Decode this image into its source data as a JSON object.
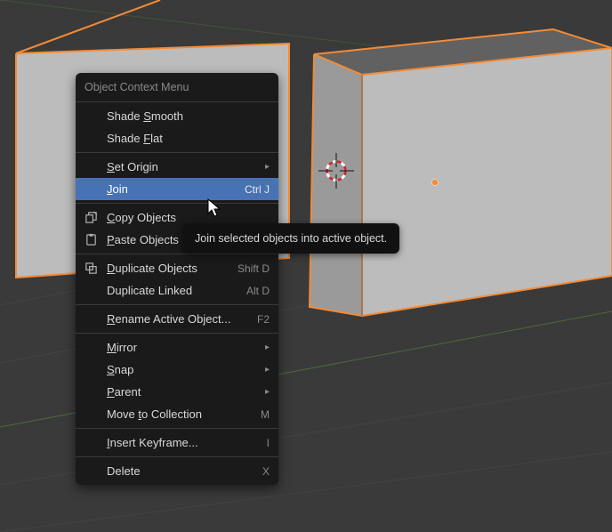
{
  "menu": {
    "title": "Object Context Menu",
    "groups": [
      [
        {
          "label": "Shade Smooth",
          "u": 6
        },
        {
          "label": "Shade Flat",
          "u": 6
        }
      ],
      [
        {
          "label": "Set Origin",
          "u": 0,
          "submenu": true
        },
        {
          "label": "Join",
          "u": 0,
          "hotkey": "Ctrl J",
          "hover": true
        }
      ],
      [
        {
          "label": "Copy Objects",
          "u": 0,
          "icon": "copy"
        },
        {
          "label": "Paste Objects",
          "u": 0,
          "icon": "paste"
        }
      ],
      [
        {
          "label": "Duplicate Objects",
          "u": 0,
          "icon": "duplicate",
          "hotkey": "Shift D"
        },
        {
          "label": "Duplicate Linked",
          "hotkey": "Alt D"
        }
      ],
      [
        {
          "label": "Rename Active Object...",
          "u": 0,
          "hotkey": "F2"
        }
      ],
      [
        {
          "label": "Mirror",
          "u": 0,
          "submenu": true
        },
        {
          "label": "Snap",
          "u": 0,
          "submenu": true
        },
        {
          "label": "Parent",
          "u": 0,
          "submenu": true
        },
        {
          "label": "Move to Collection",
          "u": 5,
          "hotkey": "M"
        }
      ],
      [
        {
          "label": "Insert Keyframe...",
          "u": 0,
          "hotkey": "I"
        }
      ],
      [
        {
          "label": "Delete",
          "hotkey": "X"
        }
      ]
    ]
  },
  "tooltip": "Join selected objects into active object.",
  "scene": {
    "cube_left": {
      "outline": "#f38b36",
      "fill_top": "#5a5a5a",
      "fill_front": "#b7b7b7",
      "fill_side": "#8e8e8e"
    },
    "cube_right": {
      "outline": "#f38b36",
      "fill_top": "#5f5f5f",
      "fill_front": "#b7b7b7",
      "fill_side": "#8e8e8e"
    },
    "origin_dot": "#f38b36",
    "cursor_ring_dark": "#b4222f",
    "cursor_ring_light": "#ffffff",
    "grid": "#4a4a4a",
    "axis_x": "#7a3a3a",
    "axis_y": "#4e6a3d",
    "axis_z": "#3c4c6c"
  }
}
